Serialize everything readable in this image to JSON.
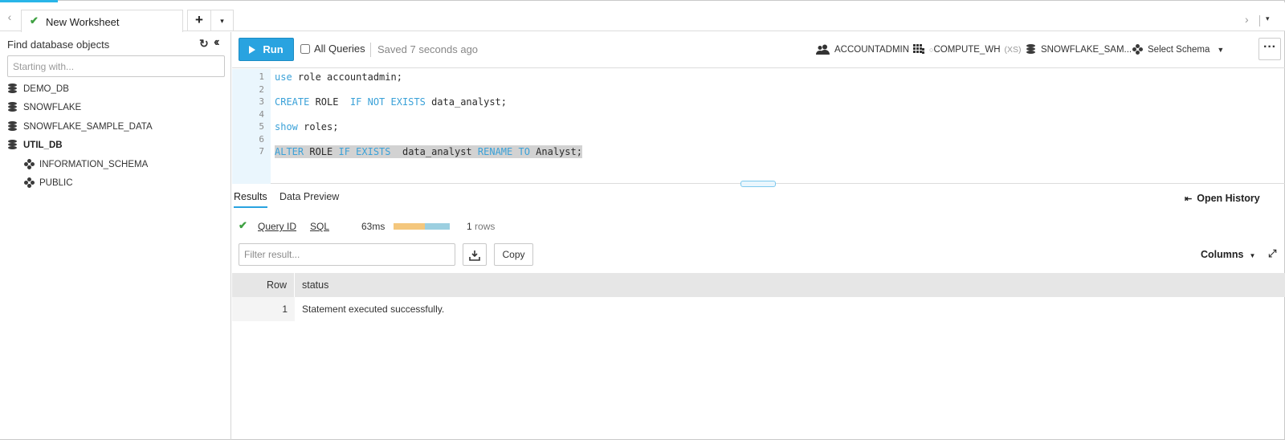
{
  "tabs": {
    "active_tab_label": "New Worksheet",
    "add_label": "+",
    "dropdown_label": "▾"
  },
  "sidebar": {
    "title": "Find database objects",
    "search_placeholder": "Starting with...",
    "items": [
      {
        "label": "DEMO_DB",
        "type": "database"
      },
      {
        "label": "SNOWFLAKE",
        "type": "database"
      },
      {
        "label": "SNOWFLAKE_SAMPLE_DATA",
        "type": "database"
      },
      {
        "label": "UTIL_DB",
        "type": "database",
        "selected": true
      },
      {
        "label": "INFORMATION_SCHEMA",
        "type": "schema"
      },
      {
        "label": "PUBLIC",
        "type": "schema"
      }
    ]
  },
  "toolbar": {
    "run_label": "Run",
    "all_queries_label": "All Queries",
    "all_queries_checked": false,
    "saved_status": "Saved 7 seconds ago",
    "role": "ACCOUNTADMIN",
    "warehouse": "COMPUTE_WH",
    "warehouse_size": "(XS)",
    "database": "SNOWFLAKE_SAM...",
    "schema": "Select Schema"
  },
  "editor": {
    "lines": [
      {
        "num": "1",
        "text": "use role accountadmin;"
      },
      {
        "num": "2",
        "text": ""
      },
      {
        "num": "3",
        "text": "CREATE ROLE  IF NOT EXISTS data_analyst;"
      },
      {
        "num": "4",
        "text": ""
      },
      {
        "num": "5",
        "text": "show roles;"
      },
      {
        "num": "6",
        "text": ""
      },
      {
        "num": "7",
        "text": "ALTER ROLE IF EXISTS  data_analyst RENAME TO Analyst;"
      }
    ]
  },
  "results": {
    "tabs": [
      "Results",
      "Data Preview"
    ],
    "active_tab": "Results",
    "open_history_label": "Open History",
    "query_id_label": "Query ID",
    "sql_label": "SQL",
    "duration": "63ms",
    "duration_bar_split": 0.55,
    "row_count": "1",
    "row_count_suffix": "rows",
    "filter_placeholder": "Filter result...",
    "copy_label": "Copy",
    "columns_label": "Columns",
    "grid": {
      "headers": [
        "Row",
        "status"
      ],
      "rows": [
        {
          "row": "1",
          "status": "Statement executed successfully."
        }
      ]
    }
  },
  "colors": {
    "accent": "#29a3e0",
    "keyword": "#3aa1d8",
    "success": "#3fa142",
    "bar_compile": "#f4c77d",
    "bar_exec": "#9ccfe0"
  }
}
